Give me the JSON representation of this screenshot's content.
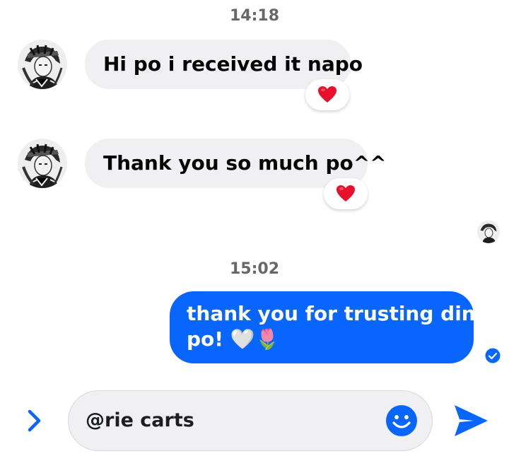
{
  "conversation": {
    "timestamps": [
      "14:18",
      "15:02"
    ],
    "incoming": [
      {
        "text": "Hi po i received it napo",
        "reaction": "❤️"
      },
      {
        "text": "Thank you so much po^^",
        "reaction": "❤️"
      }
    ],
    "outgoing": {
      "lines": [
        "thank you for trusting din",
        "po! 🤍🌷"
      ],
      "status": "delivered"
    }
  },
  "composer": {
    "value": "@rie carts",
    "icons": {
      "expand": "chevron-right-icon",
      "emoji": "smiley-icon",
      "send": "send-icon"
    }
  },
  "colors": {
    "accent": "#0866ff",
    "incoming_bubble": "#f0f0f2",
    "timestamp": "#65676b",
    "reaction_heart": "#e8112d"
  }
}
